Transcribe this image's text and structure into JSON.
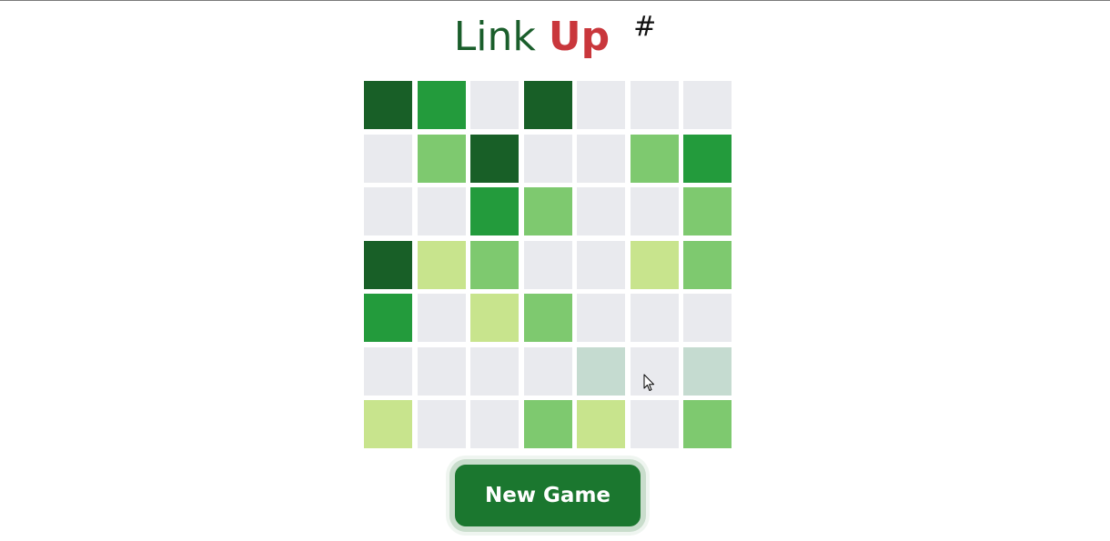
{
  "title": {
    "word_one": "Link",
    "word_two": "Up",
    "superscript": "#"
  },
  "colors": {
    "empty": "#e9eaee",
    "lime": "#c8e48d",
    "light_green": "#7ec96f",
    "green": "#239b3c",
    "dark_green": "#185f27",
    "pale_teal": "#c5dbd0",
    "button_bg": "#1b772f",
    "title_link": "#1a5e2b",
    "title_up": "#c9373c"
  },
  "board": {
    "rows": 7,
    "cols": 7,
    "cells": [
      [
        "dark_green",
        "green",
        "empty",
        "dark_green",
        "empty",
        "empty",
        "empty"
      ],
      [
        "empty",
        "light_green",
        "dark_green",
        "empty",
        "empty",
        "light_green",
        "green"
      ],
      [
        "empty",
        "empty",
        "green",
        "light_green",
        "empty",
        "empty",
        "light_green"
      ],
      [
        "dark_green",
        "lime",
        "light_green",
        "empty",
        "empty",
        "lime",
        "light_green"
      ],
      [
        "green",
        "empty",
        "lime",
        "light_green",
        "empty",
        "empty",
        "empty"
      ],
      [
        "empty",
        "empty",
        "empty",
        "empty",
        "pale_teal",
        "empty",
        "pale_teal"
      ],
      [
        "lime",
        "empty",
        "empty",
        "light_green",
        "lime",
        "empty",
        "light_green"
      ]
    ]
  },
  "new_game_button": {
    "label": "New Game"
  }
}
